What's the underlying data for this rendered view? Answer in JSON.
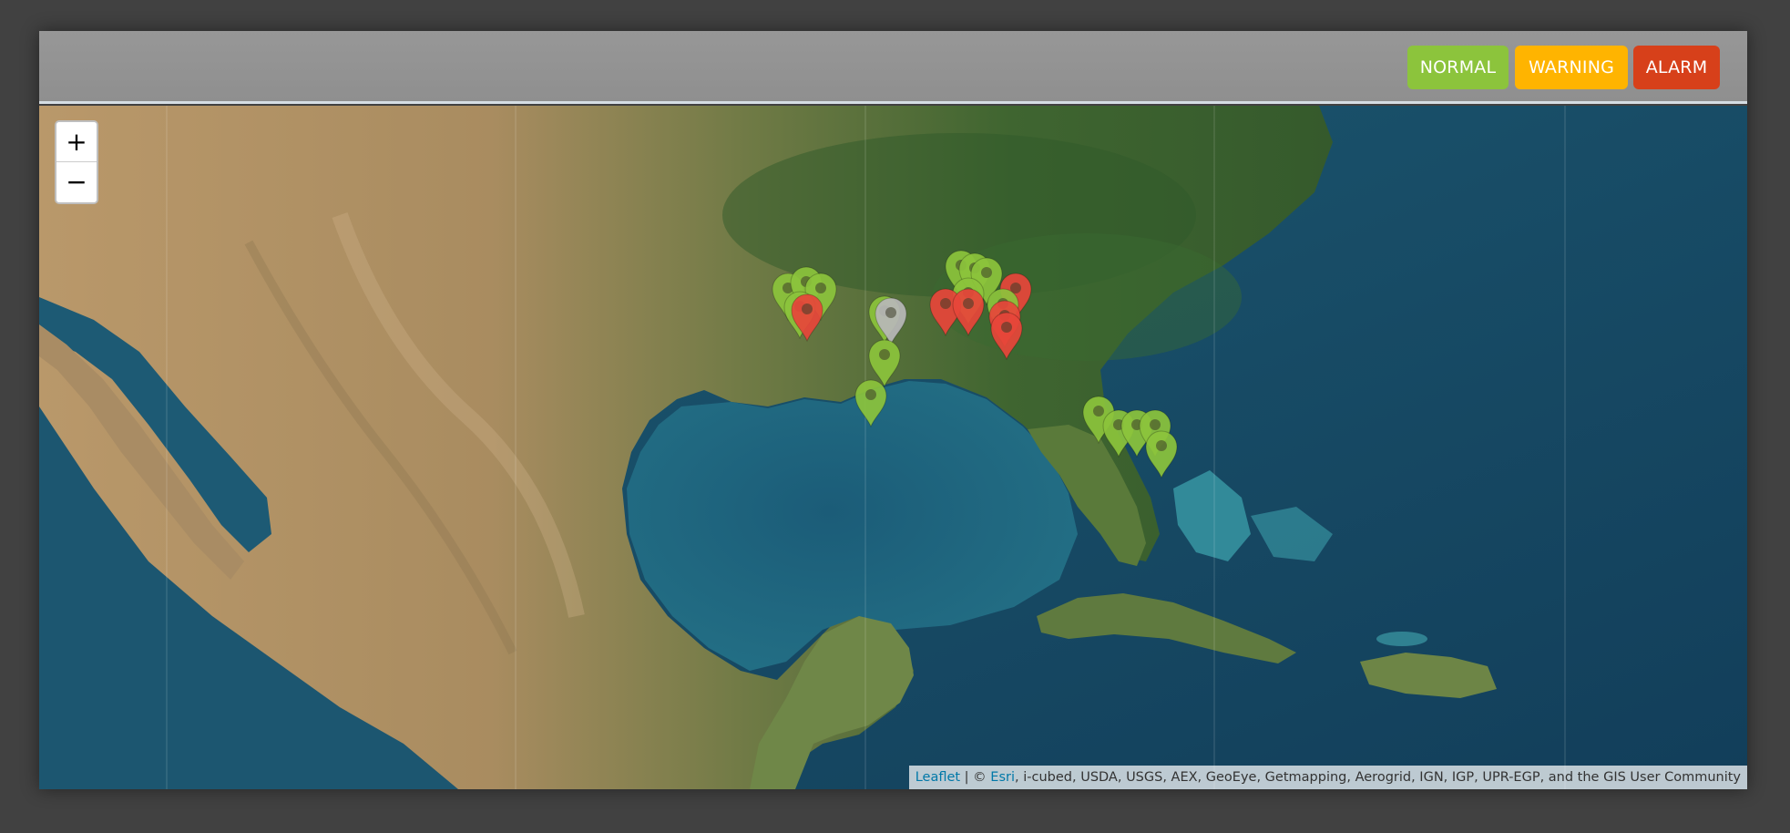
{
  "legend": {
    "normal": {
      "label": "NORMAL",
      "color": "#8cc43c"
    },
    "warning": {
      "label": "WARNING",
      "color": "#ffb400"
    },
    "alarm": {
      "label": "ALARM",
      "color": "#d7401a"
    }
  },
  "map": {
    "zoom_in_label": "+",
    "zoom_out_label": "−",
    "colors": {
      "water": "#1f5a72",
      "land": "#b49a6e",
      "forest": "#4a6b32"
    },
    "attribution": {
      "leaflet": "Leaflet",
      "separator": " | © ",
      "esri": "Esri",
      "sources": ", i-cubed, USDA, USGS, AEX, GeoEye, Getmapping, Aerogrid, IGN, IGP, UPR-EGP, and the GIS User Community"
    },
    "marker_icon": "map-pin-icon",
    "markers": [
      {
        "status": "normal"
      },
      {
        "status": "normal"
      },
      {
        "status": "normal"
      },
      {
        "status": "normal"
      },
      {
        "status": "alarm"
      },
      {
        "status": "normal"
      },
      {
        "status": "offline"
      },
      {
        "status": "normal"
      },
      {
        "status": "normal"
      },
      {
        "status": "normal"
      },
      {
        "status": "normal"
      },
      {
        "status": "normal"
      },
      {
        "status": "normal"
      },
      {
        "status": "alarm"
      },
      {
        "status": "alarm"
      },
      {
        "status": "alarm"
      },
      {
        "status": "normal"
      },
      {
        "status": "alarm"
      },
      {
        "status": "alarm"
      },
      {
        "status": "normal"
      },
      {
        "status": "normal"
      },
      {
        "status": "normal"
      },
      {
        "status": "normal"
      },
      {
        "status": "normal"
      }
    ]
  }
}
